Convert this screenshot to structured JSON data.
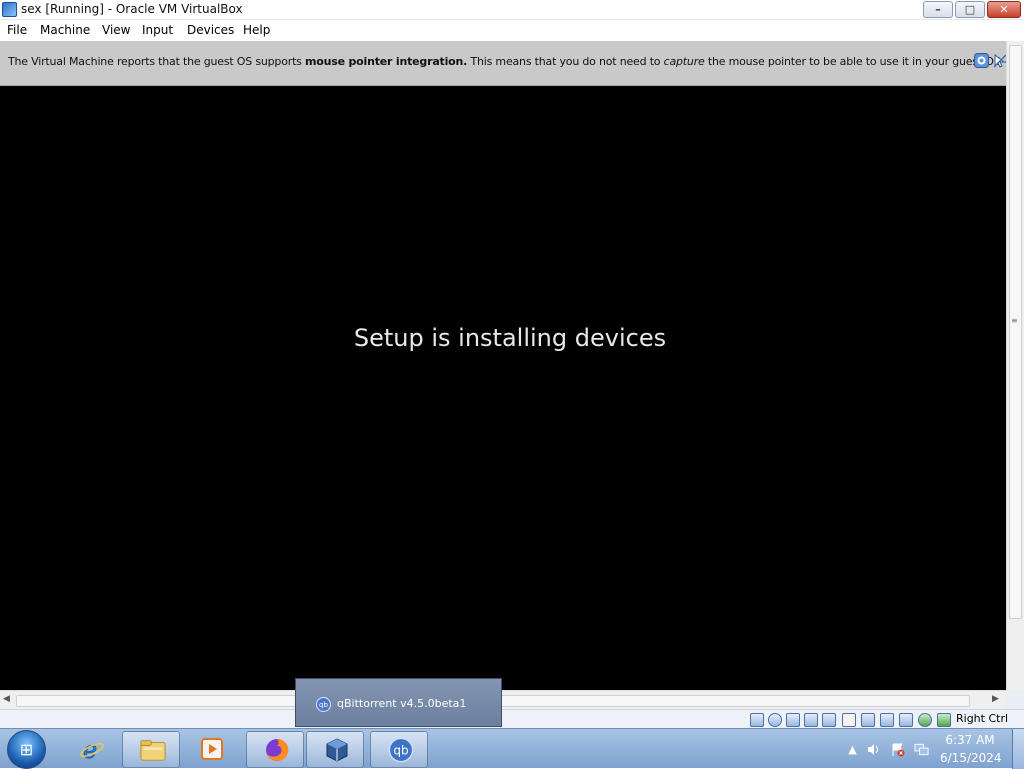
{
  "window": {
    "title": "sex [Running] - Oracle VM VirtualBox",
    "controls": {
      "minimize": "–",
      "maximize": "□",
      "close": "✕"
    }
  },
  "menubar": {
    "items": [
      "File",
      "Machine",
      "View",
      "Input",
      "Devices",
      "Help"
    ]
  },
  "banner": {
    "part1": "The Virtual Machine reports that the guest OS supports ",
    "bold": "mouse pointer integration.",
    "part2": " This means that you do not need to ",
    "italic": "capture",
    "part3": " the mouse pointer to be able to use it in your guest OS -- all mouse",
    "help_icon": "info-icon",
    "close_icon": "mouse-integration-icon"
  },
  "vm": {
    "message": "Setup is installing devices",
    "background_color": "#000000"
  },
  "statusbar": {
    "host_key": "Right Ctrl",
    "icons": [
      "hard-disk-icon",
      "optical-drive-icon",
      "audio-icon",
      "network-icon",
      "usb-icon",
      "shared-folders-icon",
      "display-icon",
      "video-capture-icon",
      "cpu-icon",
      "mouse-integration-icon",
      "keyboard-icon"
    ]
  },
  "popup": {
    "label": "qBittorrent v4.5.0beta1"
  },
  "taskbar": {
    "start_glyph": "⊞",
    "apps": [
      {
        "name": "internet-explorer-icon",
        "glyph": "e"
      },
      {
        "name": "file-explorer-icon",
        "glyph": "📁"
      },
      {
        "name": "media-player-icon",
        "glyph": "▶"
      },
      {
        "name": "firefox-icon",
        "glyph": "●"
      },
      {
        "name": "virtualbox-icon",
        "glyph": "▣"
      },
      {
        "name": "qbittorrent-icon",
        "glyph": "qb"
      }
    ],
    "tray": {
      "chevron": "▲",
      "time": "6:37 AM",
      "date": "6/15/2024"
    }
  },
  "scrollbars": {
    "left_arrow": "◀",
    "right_arrow": "▶",
    "grip": "≡"
  }
}
